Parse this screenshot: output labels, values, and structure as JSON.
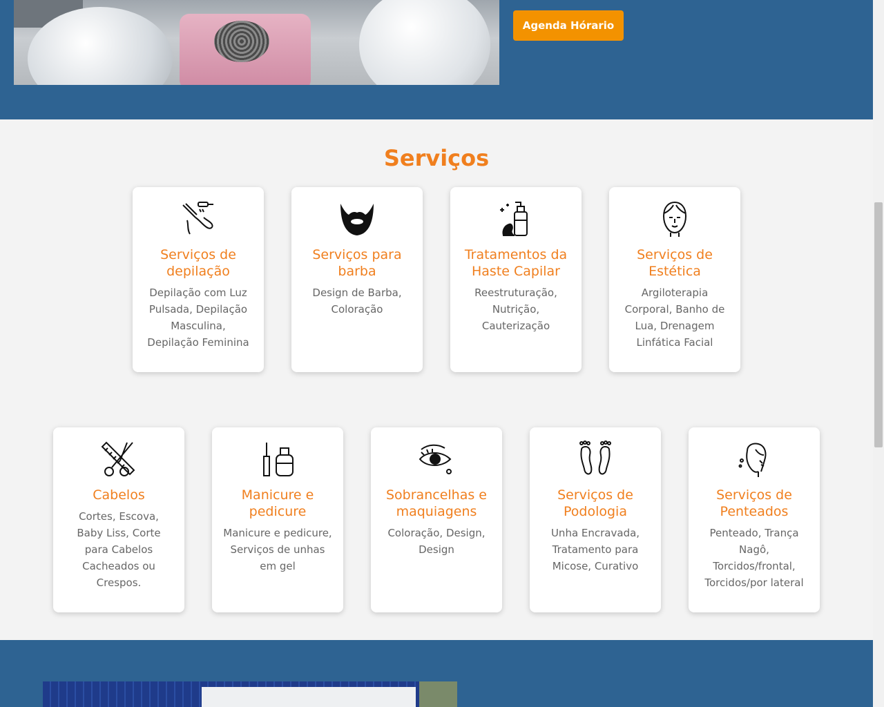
{
  "hero": {
    "cta_label": "Agenda Hórario",
    "photo_alt": "Equipamentos de estética"
  },
  "services": {
    "title": "Serviços",
    "row1": [
      {
        "name": "Serviços de depilação",
        "desc": "Depilação com Luz Pulsada, Depilação Masculina, Depilação Feminina",
        "icon": "depilation-icon"
      },
      {
        "name": "Serviços para barba",
        "desc": "Design de Barba, Coloração",
        "icon": "beard-icon"
      },
      {
        "name": "Tratamentos da Haste Capilar",
        "desc": "Reestruturação, Nutrição, Cauterização",
        "icon": "hair-product-icon"
      },
      {
        "name": "Serviços de Estética",
        "desc": "Argiloterapia Corporal, Banho de Lua, Drenagem Linfática Facial",
        "icon": "face-icon"
      }
    ],
    "row2": [
      {
        "name": "Cabelos",
        "desc": "Cortes, Escova, Baby Liss, Corte para Cabelos Cacheados ou Crespos.",
        "icon": "comb-scissors-icon"
      },
      {
        "name": "Manicure e pedicure",
        "desc": "Manicure e pedicure, Serviços de unhas em gel",
        "icon": "nail-polish-icon"
      },
      {
        "name": "Sobrancelhas e maquiagens",
        "desc": "Coloração, Design, Design",
        "icon": "eye-makeup-icon"
      },
      {
        "name": "Serviços de Podologia",
        "desc": "Unha Encravada, Tratamento para Micose, Curativo",
        "icon": "feet-icon"
      },
      {
        "name": "Serviços de Penteados",
        "desc": "Penteado, Trança Nagô, Torcidos/frontal, Torcidos/por lateral",
        "icon": "hairstyle-icon"
      }
    ]
  },
  "colors": {
    "header_blue": "#2e6392",
    "accent_orange": "#f07f1e",
    "button_orange": "#f39200"
  }
}
